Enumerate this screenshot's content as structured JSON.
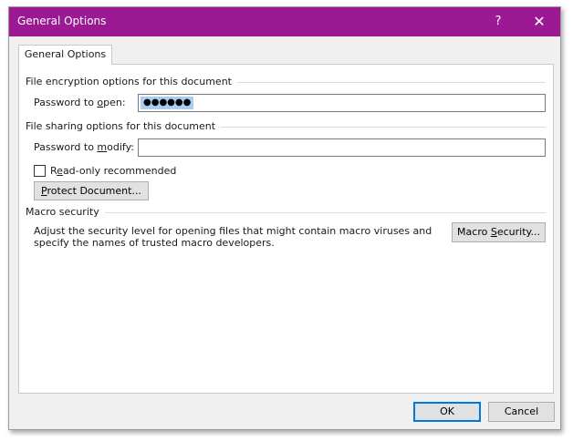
{
  "window": {
    "title": "General Options",
    "help_glyph": "?",
    "close_glyph": "✕"
  },
  "tabs": [
    {
      "label": "General Options",
      "active": true
    }
  ],
  "encryption": {
    "group_label": "File encryption options for this document",
    "password_open_label_pre": "Password to ",
    "password_open_label_key": "o",
    "password_open_label_post": "pen:",
    "password_open_value": "●●●●●●"
  },
  "sharing": {
    "group_label": "File sharing options for this document",
    "password_modify_label_pre": "Password to ",
    "password_modify_label_key": "m",
    "password_modify_label_post": "odify:",
    "password_modify_value": "",
    "readonly_label_pre": "R",
    "readonly_label_key": "e",
    "readonly_label_post": "ad-only recommended",
    "readonly_checked": false,
    "protect_label_key": "P",
    "protect_label_post": "rotect Document..."
  },
  "macro": {
    "group_label": "Macro security",
    "description": "Adjust the security level for opening files that might contain macro viruses and specify the names of trusted macro developers.",
    "button_label_pre": "Macro ",
    "button_label_key": "S",
    "button_label_post": "ecurity..."
  },
  "footer": {
    "ok_label": "OK",
    "cancel_label": "Cancel"
  },
  "colors": {
    "titlebar": "#9b1a93",
    "selection": "#a8cdf2",
    "default_button_border": "#0078d7"
  }
}
